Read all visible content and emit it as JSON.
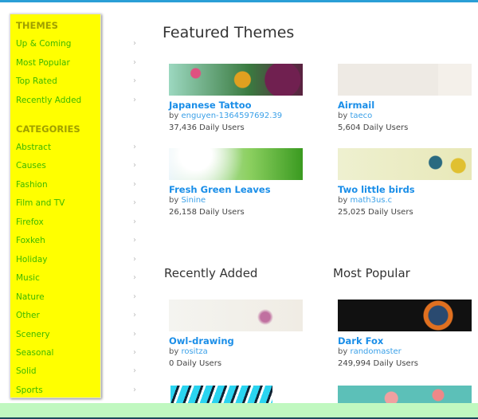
{
  "sidebar": {
    "themes_heading": "THEMES",
    "themes": [
      "Up & Coming",
      "Most Popular",
      "Top Rated",
      "Recently Added"
    ],
    "categories_heading": "CATEGORIES",
    "categories": [
      "Abstract",
      "Causes",
      "Fashion",
      "Film and TV",
      "Firefox",
      "Foxkeh",
      "Holiday",
      "Music",
      "Nature",
      "Other",
      "Scenery",
      "Seasonal",
      "Solid",
      "Sports"
    ]
  },
  "featured": {
    "heading": "Featured Themes",
    "cards": [
      {
        "title": "Japanese Tattoo",
        "by": "by",
        "author": "enguyen-1364597692.39",
        "users": "37,436 Daily Users"
      },
      {
        "title": "Airmail",
        "by": "by",
        "author": "taeco",
        "users": "5,604 Daily Users"
      },
      {
        "title": "Fresh Green Leaves",
        "by": "by",
        "author": "Sinine",
        "users": "26,158 Daily Users"
      },
      {
        "title": "Two little birds",
        "by": "by",
        "author": "math3us.c",
        "users": "25,025 Daily Users"
      }
    ]
  },
  "recent": {
    "heading": "Recently Added",
    "cards": [
      {
        "title": "Owl-drawing",
        "by": "by",
        "author": "rositza",
        "users": "0 Daily Users"
      }
    ]
  },
  "popular": {
    "heading": "Most Popular",
    "cards": [
      {
        "title": "Dark Fox",
        "by": "by",
        "author": "randomaster",
        "users": "249,994 Daily Users"
      }
    ]
  }
}
